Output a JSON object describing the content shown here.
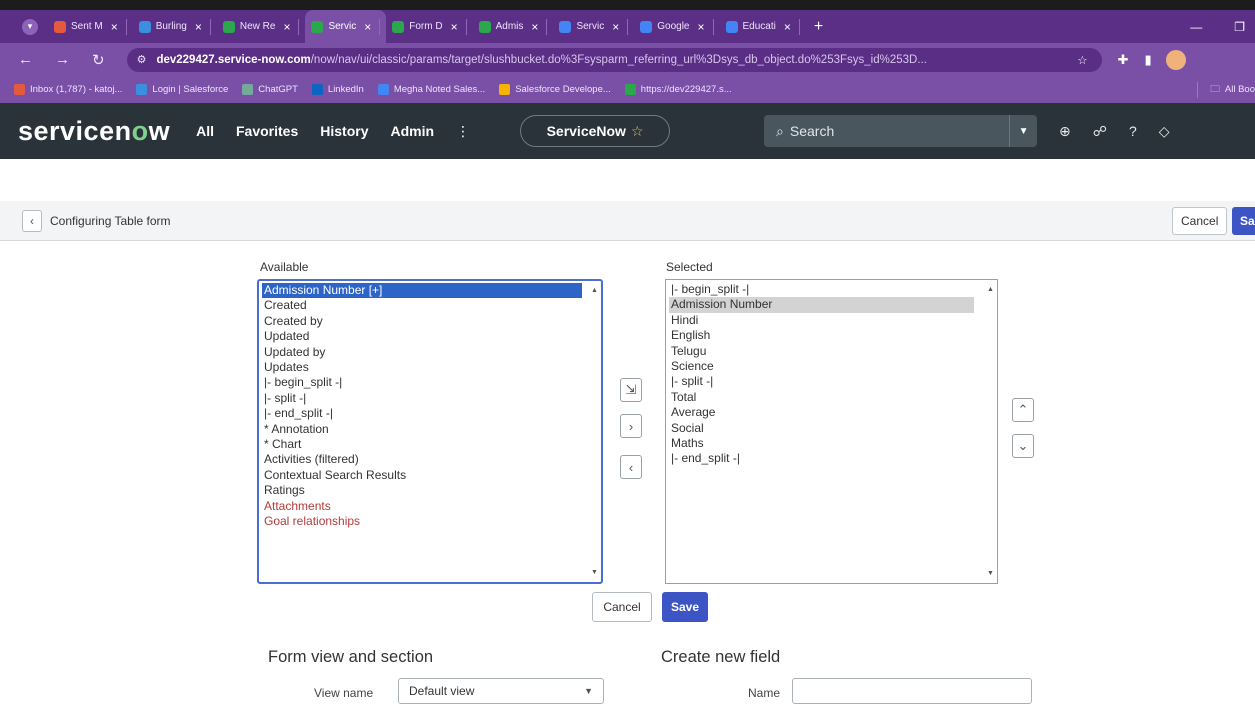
{
  "browser": {
    "tabs": [
      {
        "label": "Sent M",
        "color": "#e35a3c"
      },
      {
        "label": "Burling",
        "color": "#3a8fe0"
      },
      {
        "label": "New Re",
        "color": "#2aa84a"
      },
      {
        "label": "Servic",
        "color": "#2aa84a",
        "active": true
      },
      {
        "label": "Form D",
        "color": "#2aa84a"
      },
      {
        "label": "Admis",
        "color": "#2aa84a"
      },
      {
        "label": "Servic",
        "color": "#4285f4"
      },
      {
        "label": "Google",
        "color": "#4285f4"
      },
      {
        "label": "Educati",
        "color": "#4285f4"
      }
    ],
    "new_tab": "+",
    "url_domain": "dev229427.service-now.com",
    "url_path": "/now/nav/ui/classic/params/target/slushbucket.do%3Fsysparm_referring_url%3Dsys_db_object.do%253Fsys_id%253D...",
    "bookmarks": [
      {
        "label": "Inbox (1,787) - katoj...",
        "color": "#e35a3c"
      },
      {
        "label": "Login | Salesforce",
        "color": "#3a8fe0"
      },
      {
        "label": "ChatGPT",
        "color": "#74aa9c"
      },
      {
        "label": "LinkedIn",
        "color": "#0a66c2"
      },
      {
        "label": "Megha Noted Sales...",
        "color": "#4285f4"
      },
      {
        "label": "Salesforce Develope...",
        "color": "#f4b400"
      },
      {
        "label": "https://dev229427.s...",
        "color": "#2aa84a"
      }
    ],
    "all_bookmarks": "All Boo"
  },
  "header": {
    "logo_a": "servicen",
    "logo_o": "o",
    "logo_b": "w",
    "nav": [
      "All",
      "Favorites",
      "History",
      "Admin"
    ],
    "nav_more": "⋮",
    "scope": "ServiceNow",
    "search_placeholder": "Search"
  },
  "page": {
    "title": "Configuring Table form",
    "cancel": "Cancel",
    "save": "Sa"
  },
  "slush": {
    "available_label": "Available",
    "selected_label": "Selected",
    "available": [
      "Admission Number [+]",
      "Created",
      "Created by",
      "Updated",
      "Updated by",
      "Updates",
      "|- begin_split -|",
      "|- split -|",
      "|- end_split -|",
      "* Annotation",
      "* Chart",
      "Activities (filtered)",
      "Contextual Search Results",
      "Ratings",
      "Attachments",
      "Goal relationships"
    ],
    "selected": [
      "|- begin_split -|",
      "Admission Number",
      "Hindi",
      "English",
      "Telugu",
      "Science",
      "|- split -|",
      "Total",
      "Average",
      "Social",
      "Maths",
      "|- end_split -|"
    ],
    "cancel": "Cancel",
    "save": "Save"
  },
  "form_view": {
    "heading": "Form view and section",
    "view_label": "View name",
    "view_value": "Default view"
  },
  "new_field": {
    "heading": "Create new field",
    "name_label": "Name"
  }
}
